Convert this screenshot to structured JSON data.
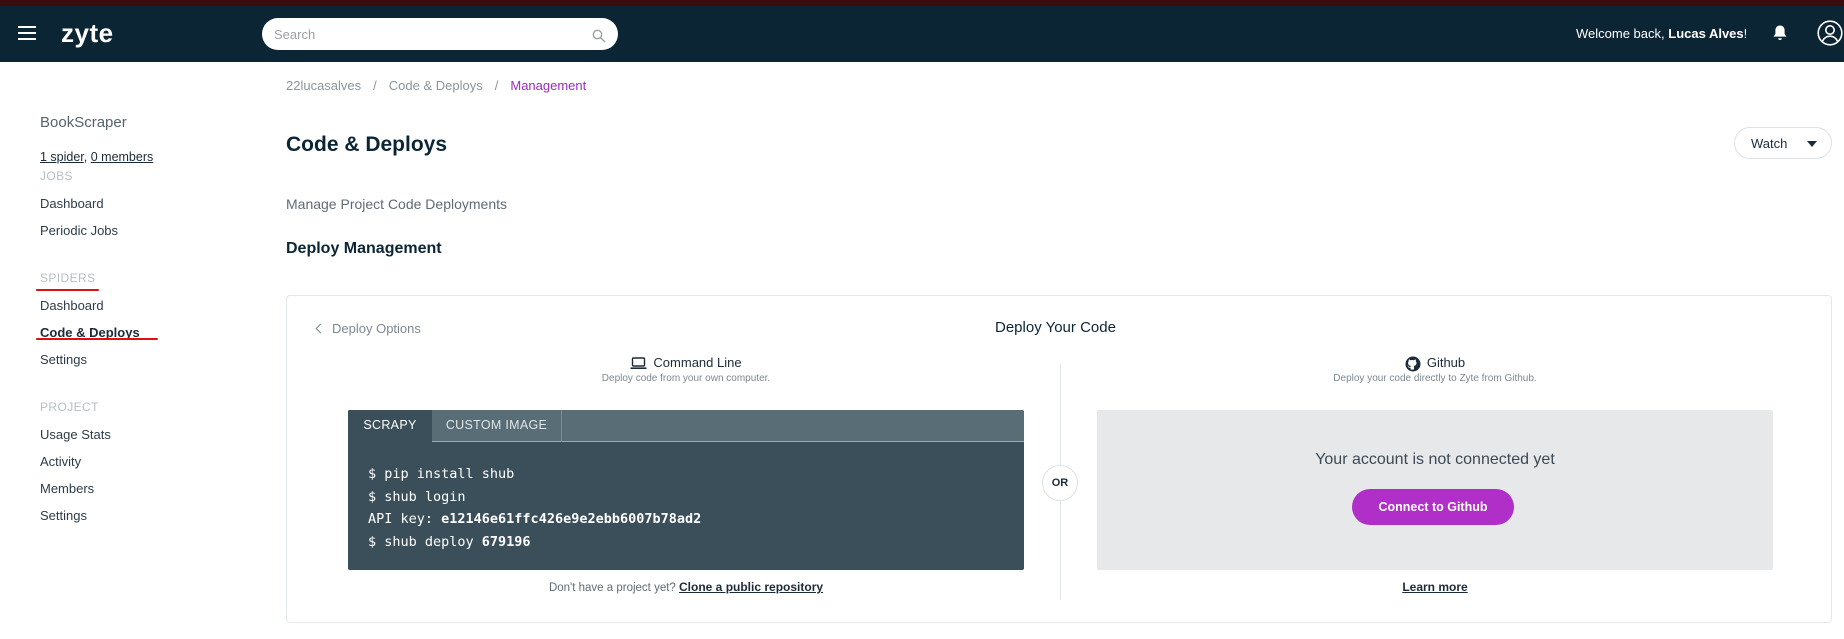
{
  "header": {
    "logo": "zyte",
    "search_placeholder": "Search",
    "welcome_prefix": "Welcome back, ",
    "user_name": "Lucas Alves",
    "welcome_suffix": "!"
  },
  "sidebar": {
    "project_name": "BookScraper",
    "spiders_link": "1 spider",
    "links_sep": ", ",
    "members_link": "0 members",
    "sections": {
      "jobs": "JOBS",
      "spiders": "SPIDERS",
      "project": "PROJECT"
    },
    "jobs_items": [
      "Dashboard",
      "Periodic Jobs"
    ],
    "spiders_items": [
      "Dashboard",
      "Code & Deploys",
      "Settings"
    ],
    "project_items": [
      "Usage Stats",
      "Activity",
      "Members",
      "Settings"
    ],
    "active_item": "Code & Deploys",
    "annotation_color": "#e01010"
  },
  "breadcrumb": {
    "items": [
      "22lucasalves",
      "Code & Deploys",
      "Management"
    ],
    "separator": "/"
  },
  "page": {
    "title": "Code & Deploys",
    "watch_label": "Watch",
    "subtitle": "Manage Project Code Deployments",
    "section_title": "Deploy Management"
  },
  "card": {
    "back_label": "Deploy Options",
    "title": "Deploy Your Code",
    "or_label": "OR",
    "command_line": {
      "title": "Command Line",
      "subtitle": "Deploy code from your own computer.",
      "icon": "laptop-icon",
      "tabs": [
        "SCRAPY",
        "CUSTOM IMAGE"
      ],
      "active_tab": "SCRAPY",
      "lines": {
        "l1": "$ pip install shub",
        "l2": "$ shub login",
        "l3_prefix": "API key: ",
        "api_key": "e12146e61ffc426e9e2ebb6007b78ad2",
        "l4_prefix": "$ shub deploy ",
        "project_id": "679196"
      },
      "no_project_text": "Don't have a project yet? ",
      "clone_link": "Clone a public repository"
    },
    "github": {
      "title": "Github",
      "subtitle": "Deploy your code directly to Zyte from Github.",
      "icon": "github-icon",
      "message": "Your account is not connected yet",
      "connect_button": "Connect to Github",
      "learn_more": "Learn more",
      "accent_color": "#b02fc9"
    }
  },
  "colors": {
    "topbar": "#0c2535",
    "breadcrumb_current": "#9a2bc3",
    "terminal_bg": "#3a4f5a"
  }
}
